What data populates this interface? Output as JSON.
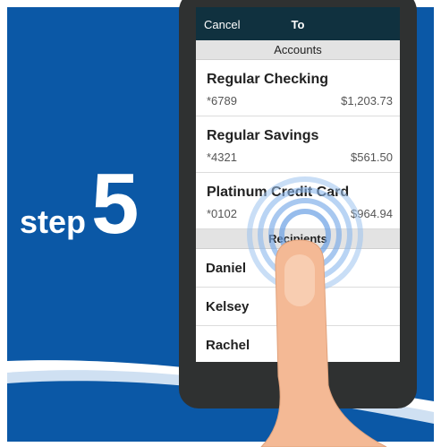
{
  "step": {
    "word": "step",
    "number": "5"
  },
  "navbar": {
    "cancel_label": "Cancel",
    "title": "To"
  },
  "accounts": {
    "header": "Accounts",
    "items": [
      {
        "name": "Regular Checking",
        "number": "*6789",
        "balance": "$1,203.73"
      },
      {
        "name": "Regular Savings",
        "number": "*4321",
        "balance": "$561.50"
      },
      {
        "name": "Platinum Credit Card",
        "number": "*0102",
        "balance": "$964.94"
      }
    ]
  },
  "recipients": {
    "header": "Recipients",
    "items": [
      {
        "name": "Daniel"
      },
      {
        "name": "Kelsey"
      },
      {
        "name": "Rachel"
      }
    ]
  },
  "colors": {
    "background": "#0b58a6",
    "navbar": "#10313f",
    "phone": "#2f3131",
    "finger": "#f4b995"
  }
}
